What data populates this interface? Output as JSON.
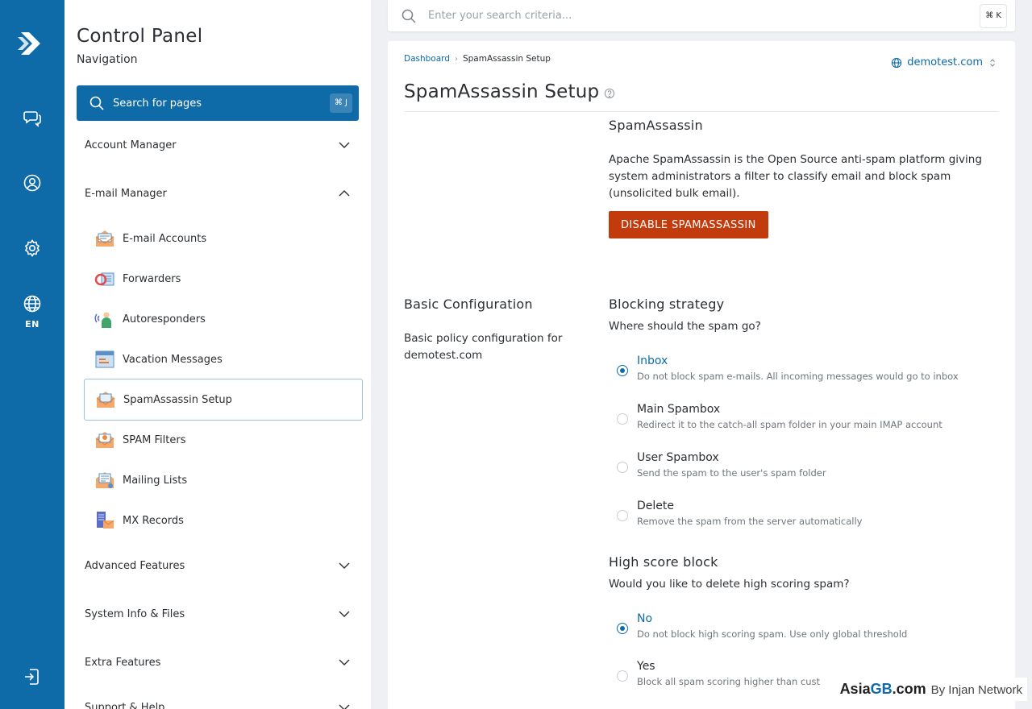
{
  "rail": {
    "language": "EN"
  },
  "nav": {
    "title": "Control Panel",
    "subtitle": "Navigation",
    "search_label": "Search for pages",
    "search_shortcut": "⌘ J",
    "sections": [
      {
        "label": "Account Manager"
      },
      {
        "label": "E-mail Manager"
      },
      {
        "label": "Advanced Features"
      },
      {
        "label": "System Info & Files"
      },
      {
        "label": "Extra Features"
      },
      {
        "label": "Support & Help"
      }
    ],
    "email_items": [
      {
        "label": "E-mail Accounts"
      },
      {
        "label": "Forwarders"
      },
      {
        "label": "Autoresponders"
      },
      {
        "label": "Vacation Messages"
      },
      {
        "label": "SpamAssassin Setup"
      },
      {
        "label": "SPAM Filters"
      },
      {
        "label": "Mailing Lists"
      },
      {
        "label": "MX Records"
      }
    ]
  },
  "topsearch": {
    "placeholder": "Enter your search criteria...",
    "shortcut": "⌘ K"
  },
  "breadcrumb": {
    "root": "Dashboard",
    "current": "SpamAssassin Setup"
  },
  "domain_select": {
    "value": "demotest.com"
  },
  "page": {
    "title": "SpamAssassin Setup"
  },
  "spamassassin": {
    "heading": "SpamAssassin",
    "description": "Apache SpamAssassin is the Open Source anti-spam platform giving system administrators a filter to classify email and block spam (unsolicited bulk email).",
    "disable_button": "DISABLE SPAMASSASSIN"
  },
  "basic_config": {
    "heading": "Basic Configuration",
    "description": "Basic policy configuration for demotest.com"
  },
  "blocking": {
    "heading": "Blocking strategy",
    "question": "Where should the spam go?",
    "options": [
      {
        "label": "Inbox",
        "desc": "Do not block spam e-mails. All incoming messages would go to inbox"
      },
      {
        "label": "Main Spambox",
        "desc": "Redirect it to the catch-all spam folder in your main IMAP account"
      },
      {
        "label": "User Spambox",
        "desc": "Send the spam to the user's spam folder"
      },
      {
        "label": "Delete",
        "desc": "Remove the spam from the server automatically"
      }
    ],
    "selected": "Inbox"
  },
  "highscore": {
    "heading": "High score block",
    "question": "Would you like to delete high scoring spam?",
    "options": [
      {
        "label": "No",
        "desc": "Do not block high scoring spam. Use only global threshold"
      },
      {
        "label": "Yes",
        "desc": "Block all spam scoring higher than cust"
      }
    ],
    "selected": "No"
  },
  "watermark": {
    "part1": "Asia",
    "part2": "GB",
    "part3": ".com",
    "tagline": "By Injan Network"
  },
  "colors": {
    "brand_blue": "#0f6aa8",
    "danger": "#c23b0d"
  }
}
